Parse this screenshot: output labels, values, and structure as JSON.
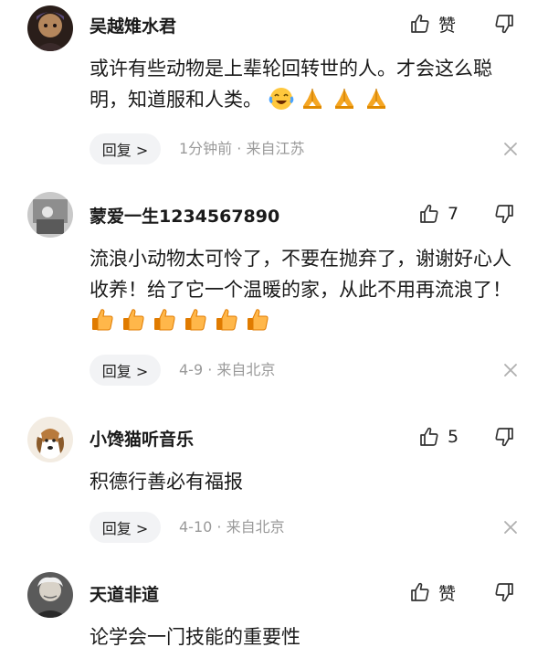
{
  "comments": [
    {
      "username": "吴越雉水君",
      "like_label": "赞",
      "text": "或许有些动物是上辈轮回转世的人。才会这么聪明，知道服和人类。",
      "emojis": [
        "crying-laughing-emoji",
        "praying-hands-emoji",
        "praying-hands-emoji",
        "praying-hands-emoji"
      ],
      "reply_label": "回复 >",
      "meta": "1分钟前 · 来自江苏"
    },
    {
      "username": "蒙爱一生1234567890",
      "like_label": "7",
      "text": "流浪小动物太可怜了，不要在抛弃了，谢谢好心人收养！给了它一个温暖的家，从此不用再流浪了！",
      "emojis": [
        "thumbs-up-emoji",
        "thumbs-up-emoji",
        "thumbs-up-emoji",
        "thumbs-up-emoji",
        "thumbs-up-emoji",
        "thumbs-up-emoji"
      ],
      "reply_label": "回复 >",
      "meta": "4-9 · 来自北京"
    },
    {
      "username": "小馋猫听音乐",
      "like_label": "5",
      "text": "积德行善必有福报",
      "reply_label": "回复 >",
      "meta": "4-10 · 来自北京"
    },
    {
      "username": "天道非道",
      "like_label": "赞",
      "text": "论学会一门技能的重要性"
    }
  ],
  "colors": {
    "text": "#1a1a1a",
    "meta": "#9a9a9a",
    "reply_bg": "#f2f3f5",
    "icon": "#333333"
  }
}
